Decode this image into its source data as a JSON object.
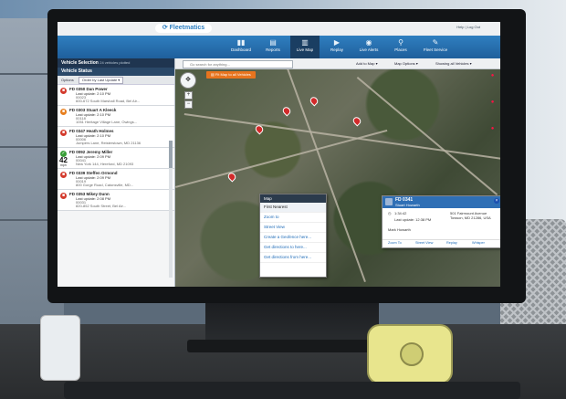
{
  "brand": "Fleetmatics",
  "toplinks": "Help  |  Log Out",
  "nav": [
    {
      "label": "Dashboard",
      "icon": "▮▮"
    },
    {
      "label": "Reports",
      "icon": "▤"
    },
    {
      "label": "Live Map",
      "icon": "▥"
    },
    {
      "label": "Replay",
      "icon": "▶"
    },
    {
      "label": "Live Alerts",
      "icon": "◉"
    },
    {
      "label": "Places",
      "icon": "⚲"
    },
    {
      "label": "Fleet Service",
      "icon": "✎"
    }
  ],
  "sidebar": {
    "title": "Vehicle Selection",
    "subtitle": "24 vehicles plotted",
    "status_header": "Vehicle Status",
    "options_label": "Options",
    "sort_value": "Order by Last Update",
    "vehicles": [
      {
        "name": "FD 0350 Dan Power",
        "color": "#d33a2c",
        "update": "Last update: 2:10 PM",
        "id": "00023",
        "addr": "600-672 South Marshall Road, Bel Air..."
      },
      {
        "name": "FD 0303 Stuart A Kleeck",
        "color": "#e77f1f",
        "update": "Last update: 2:10 PM",
        "id": "00118",
        "addr": "1051 Heritage Village Lane, Owings..."
      },
      {
        "name": "FD 0347 Heath Holmes",
        "color": "#d33a2c",
        "update": "Last update: 2:10 PM",
        "id": "00006",
        "addr": "Jumpers Lane, Reisterstown, MD 21136"
      },
      {
        "name": "FD 0092 Jeremy Miller",
        "color": "#3a9e38",
        "update": "Last update: 2:09 PM",
        "id": "00041",
        "addr": "New York 144, Hereford, MD 21093",
        "speed": "42",
        "speed_unit": "mph"
      },
      {
        "name": "FD 0339 Steffen Ormond",
        "color": "#d33a2c",
        "update": "Last update: 2:09 PM",
        "id": "00019",
        "addr": "800 Gorge Road, Catonsville, MD..."
      },
      {
        "name": "FD 0353 Mikey Dunn",
        "color": "#d33a2c",
        "update": "Last update: 2:08 PM",
        "id": "00031",
        "addr": "820-852 South Street, Bel Air..."
      }
    ]
  },
  "map": {
    "search_placeholder": "Go search for anything...",
    "add_to_map": "Add to Map",
    "map_options": "Map Options",
    "showing": "Showing all Vehicles",
    "fit_button": "Fit Map to all Vehicles",
    "zoom_in": "+",
    "zoom_out": "−"
  },
  "context_menu": {
    "title": "Map",
    "items": [
      "First Nearest",
      "Zoom to",
      "Street View",
      "Create a Geofence here...",
      "Get directions to here...",
      "Get directions from here..."
    ]
  },
  "popup": {
    "title": "FD 0341",
    "driver": "Stuart Howarth",
    "close": "×",
    "time": "1:34:42",
    "last_update": "Last update: 12:38 PM",
    "address": "501 Fairmount Avenue Towson, MD 21286, USA",
    "driver_line": "Mark Howarth",
    "actions": [
      "Zoom To",
      "Street View",
      "Replay",
      "Whisper"
    ]
  }
}
